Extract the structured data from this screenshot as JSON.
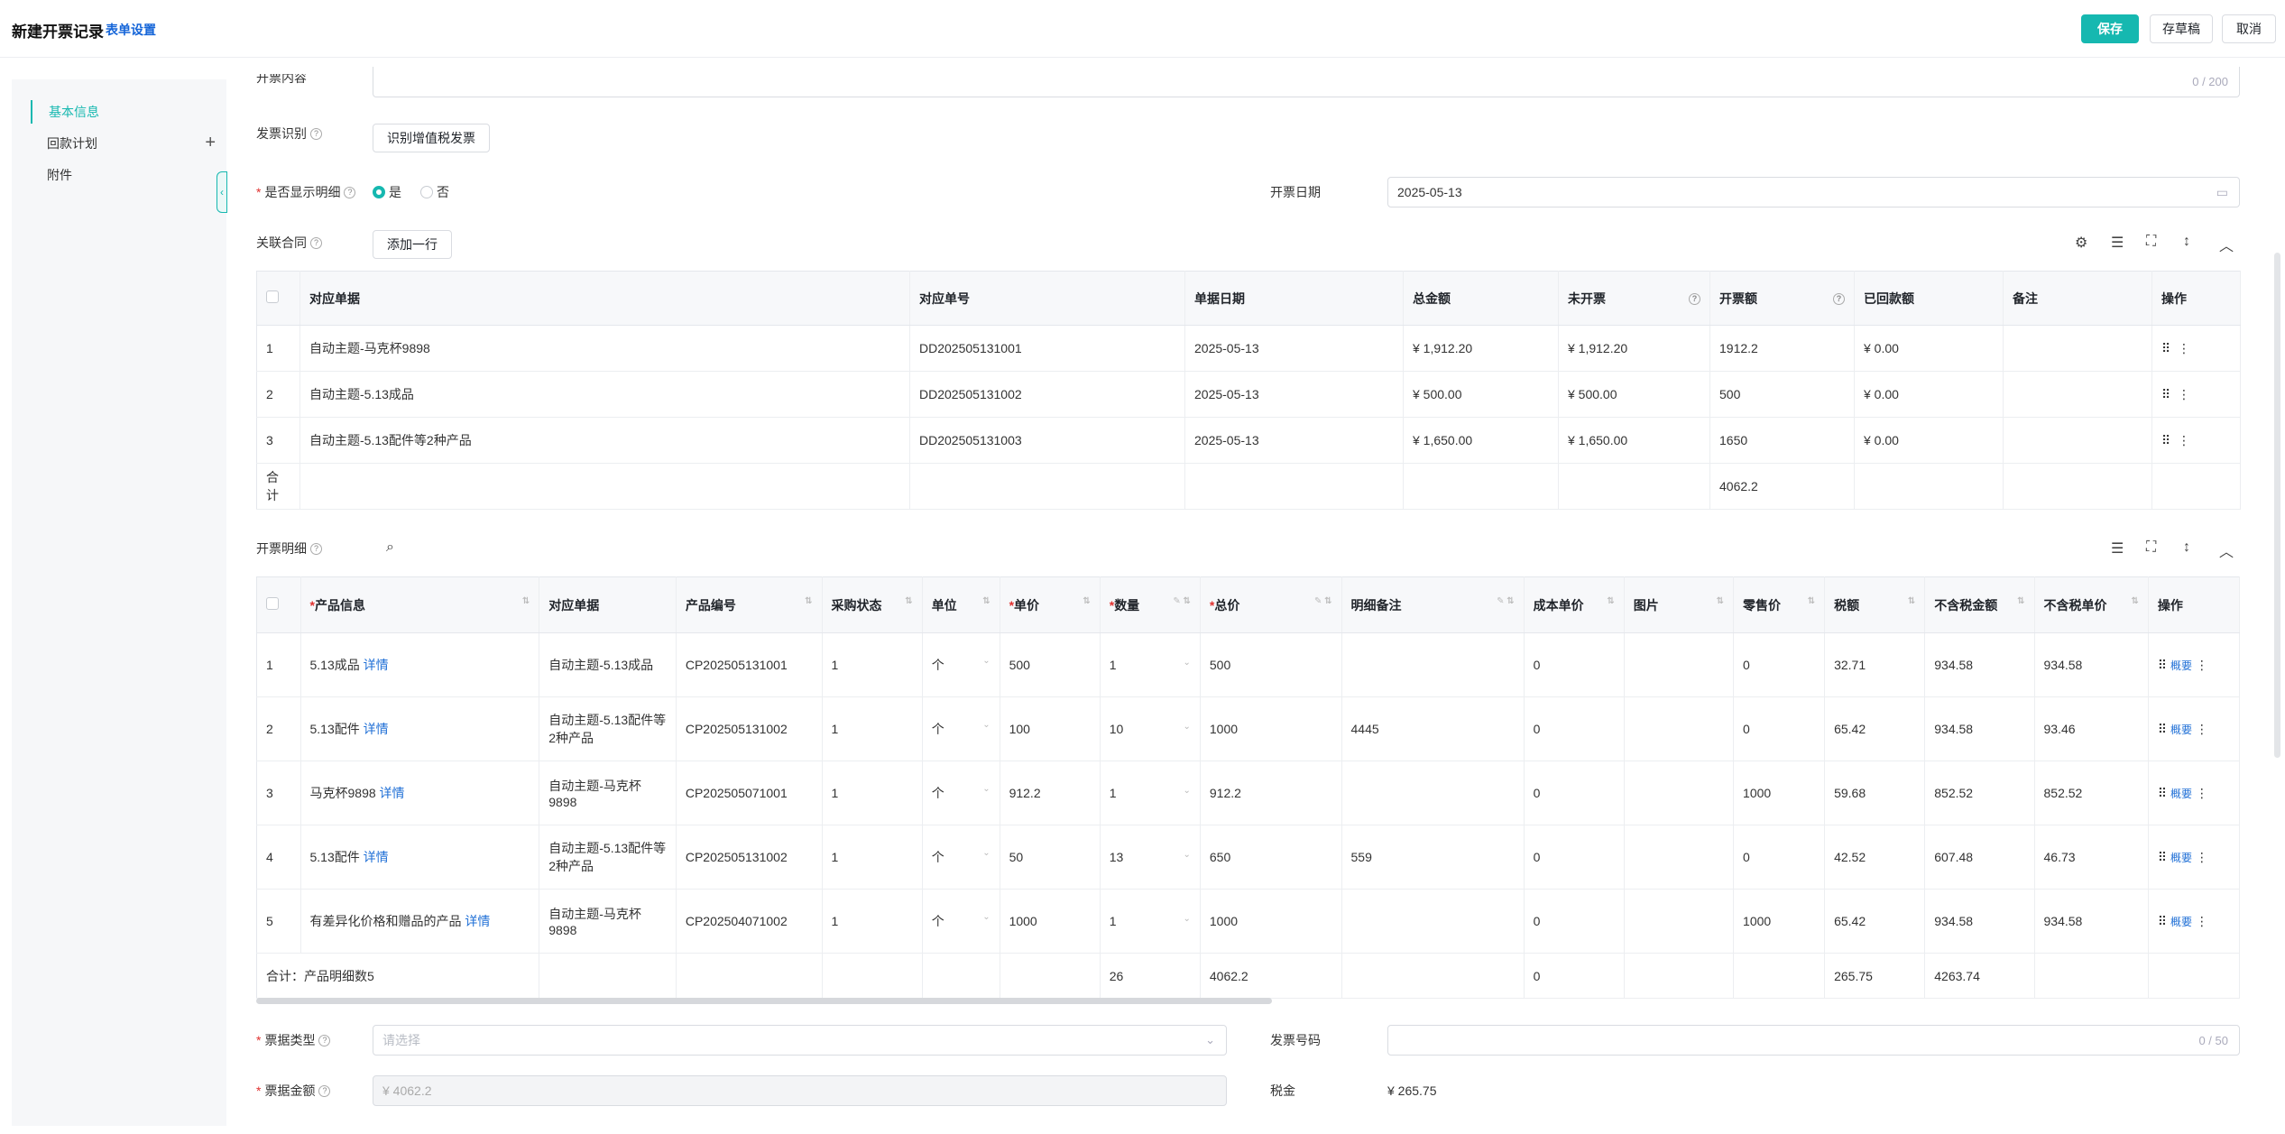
{
  "header": {
    "title": "新建开票记录",
    "form_settings": "表单设置",
    "save": "保存",
    "draft": "存草稿",
    "cancel": "取消"
  },
  "sidebar": {
    "items": [
      {
        "label": "基本信息"
      },
      {
        "label": "回款计划"
      },
      {
        "label": "附件"
      }
    ],
    "add": "+"
  },
  "form": {
    "content_label": "开票内容",
    "content_counter": "0 / 200",
    "invoice_recog_label": "发票识别",
    "recog_button": "识别增值税发票",
    "show_detail_label": "是否显示明细",
    "yes": "是",
    "no": "否",
    "invoice_date_label": "开票日期",
    "invoice_date": "2025-05-13",
    "contract_label": "关联合同",
    "add_row": "添加一行",
    "detail_label": "开票明细",
    "ticket_type_label": "票据类型",
    "ticket_type_placeholder": "请选择",
    "invoice_no_label": "发票号码",
    "invoice_no_counter": "0 / 50",
    "ticket_amount_label": "票据金额",
    "ticket_amount": "¥ 4062.2",
    "tax_label": "税金",
    "tax_value": "¥ 265.75"
  },
  "contract_table": {
    "headers": [
      "对应单据",
      "对应单号",
      "单据日期",
      "总金额",
      "未开票",
      "开票额",
      "已回款额",
      "备注",
      "操作"
    ],
    "rows": [
      {
        "no": "1",
        "doc": "自动主题-马克杯9898",
        "code": "DD202505131001",
        "date": "2025-05-13",
        "total": "¥ 1,912.20",
        "unbilled": "¥ 1,912.20",
        "amount": "1912.2",
        "paid": "¥ 0.00"
      },
      {
        "no": "2",
        "doc": "自动主题-5.13成品",
        "code": "DD202505131002",
        "date": "2025-05-13",
        "total": "¥ 500.00",
        "unbilled": "¥ 500.00",
        "amount": "500",
        "paid": "¥ 0.00"
      },
      {
        "no": "3",
        "doc": "自动主题-5.13配件等2种产品",
        "code": "DD202505131003",
        "date": "2025-05-13",
        "total": "¥ 1,650.00",
        "unbilled": "¥ 1,650.00",
        "amount": "1650",
        "paid": "¥ 0.00"
      }
    ],
    "sum_label": "合计",
    "sum_amount": "4062.2"
  },
  "detail_table": {
    "headers": [
      "产品信息",
      "对应单据",
      "产品编号",
      "采购状态",
      "单位",
      "单价",
      "数量",
      "总价",
      "明细备注",
      "成本单价",
      "图片",
      "零售价",
      "税额",
      "不含税金额",
      "不含税单价",
      "操作"
    ],
    "detail_link": "详情",
    "summary_link": "概要",
    "rows": [
      {
        "no": "1",
        "product": "5.13成品",
        "doc": "自动主题-5.13成品",
        "code": "CP202505131001",
        "status": "1",
        "unit": "个",
        "price": "500",
        "qty": "1",
        "total": "500",
        "remark": "",
        "cost": "0",
        "retail": "0",
        "tax": "32.71",
        "net": "934.58",
        "net_unit": "934.58"
      },
      {
        "no": "2",
        "product": "5.13配件",
        "doc": "自动主题-5.13配件等2种产品",
        "code": "CP202505131002",
        "status": "1",
        "unit": "个",
        "price": "100",
        "qty": "10",
        "total": "1000",
        "remark": "4445",
        "cost": "0",
        "retail": "0",
        "tax": "65.42",
        "net": "934.58",
        "net_unit": "93.46"
      },
      {
        "no": "3",
        "product": "马克杯9898",
        "doc": "自动主题-马克杯9898",
        "code": "CP202505071001",
        "status": "1",
        "unit": "个",
        "price": "912.2",
        "qty": "1",
        "total": "912.2",
        "remark": "",
        "cost": "0",
        "retail": "1000",
        "tax": "59.68",
        "net": "852.52",
        "net_unit": "852.52"
      },
      {
        "no": "4",
        "product": "5.13配件",
        "doc": "自动主题-5.13配件等2种产品",
        "code": "CP202505131002",
        "status": "1",
        "unit": "个",
        "price": "50",
        "qty": "13",
        "total": "650",
        "remark": "559",
        "cost": "0",
        "retail": "0",
        "tax": "42.52",
        "net": "607.48",
        "net_unit": "46.73"
      },
      {
        "no": "5",
        "product": "有差异化价格和赠品的产品",
        "doc": "自动主题-马克杯9898",
        "code": "CP202504071002",
        "status": "1",
        "unit": "个",
        "price": "1000",
        "qty": "1",
        "total": "1000",
        "remark": "",
        "cost": "0",
        "retail": "1000",
        "tax": "65.42",
        "net": "934.58",
        "net_unit": "934.58"
      }
    ],
    "sum": {
      "label": "合计：产品明细数5",
      "qty": "26",
      "total": "4062.2",
      "cost": "0",
      "tax": "265.75",
      "net": "4263.74"
    }
  }
}
